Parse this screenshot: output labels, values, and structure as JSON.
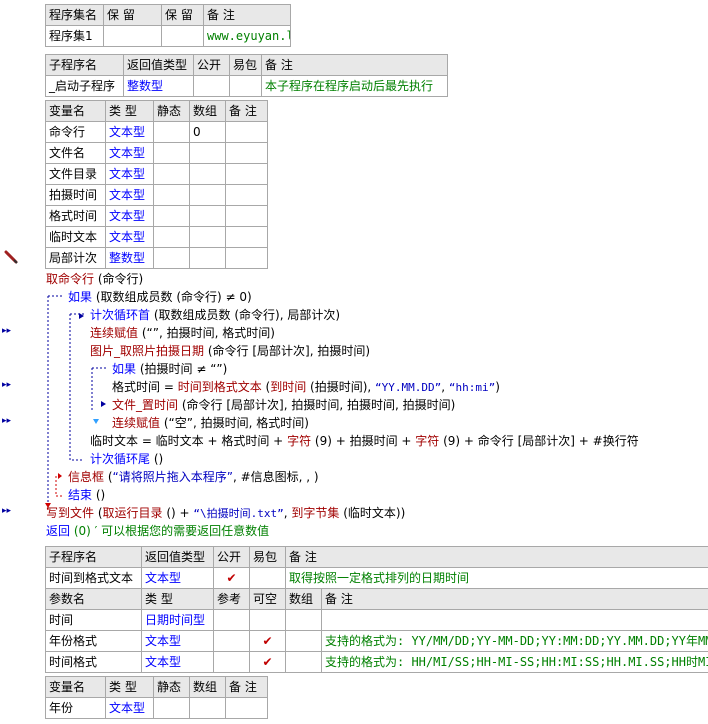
{
  "program_set": {
    "headers": [
      "程序集名",
      "保 留",
      "保 留",
      "备 注"
    ],
    "row": [
      "程序集1",
      "",
      "",
      "www.eyuyan.la"
    ]
  },
  "startup_sub": {
    "headers": [
      "子程序名",
      "返回值类型",
      "公开",
      "易包",
      "备 注"
    ],
    "row": [
      "_启动子程序",
      "整数型",
      "",
      "",
      "本子程序在程序启动后最先执行"
    ]
  },
  "vars1": {
    "headers": [
      "变量名",
      "类 型",
      "静态",
      "数组",
      "备 注"
    ],
    "rows": [
      [
        "命令行",
        "文本型",
        "",
        "0",
        ""
      ],
      [
        "文件名",
        "文本型",
        "",
        "",
        ""
      ],
      [
        "文件目录",
        "文本型",
        "",
        "",
        ""
      ],
      [
        "拍摄时间",
        "文本型",
        "",
        "",
        ""
      ],
      [
        "格式时间",
        "文本型",
        "",
        "",
        ""
      ],
      [
        "临时文本",
        "文本型",
        "",
        "",
        ""
      ],
      [
        "局部计次",
        "整数型",
        "",
        "",
        ""
      ]
    ]
  },
  "code": {
    "l1": [
      "取命令行",
      " (命令行)"
    ],
    "l2": [
      "如果",
      " (取数组成员数 (命令行) ≠ 0)"
    ],
    "l3": [
      "计次循环首",
      " (取数组成员数 (命令行), 局部计次)"
    ],
    "l4": [
      "连续赋值",
      " (“”, 拍摄时间, 格式时间)"
    ],
    "l5": [
      "图片_取照片拍摄日期",
      " (命令行 [局部计次], 拍摄时间)"
    ],
    "l6": [
      "如果",
      " (拍摄时间 ≠ “”)"
    ],
    "l7": [
      "格式时间 = ",
      "时间到格式文本",
      " (",
      "到时间",
      " (拍摄时间), ",
      "“YY.MM.DD”",
      ", ",
      "“hh:mi”",
      ")"
    ],
    "l8": [
      "文件_置时间",
      " (命令行 [局部计次], 拍摄时间, 拍摄时间, 拍摄时间)"
    ],
    "l9": [
      "连续赋值",
      " (“空”, 拍摄时间, 格式时间)"
    ],
    "l10": [
      "临时文本 = 临时文本 + 格式时间 + ",
      "字符",
      " (9) + 拍摄时间 + ",
      "字符",
      " (9) + 命令行 [局部计次] + #换行符"
    ],
    "l11": [
      "计次循环尾",
      " ()"
    ],
    "l12": [
      "信息框",
      " (",
      "“请将照片拖入本程序”",
      ", #信息图标, , )"
    ],
    "l13": [
      "结束",
      " ()"
    ],
    "l14": [
      "写到文件",
      " (",
      "取运行目录",
      " () + ",
      "“\\拍摄时间.txt”",
      ", ",
      "到字节集",
      " (临时文本))"
    ],
    "l15": [
      "返回",
      " (0)  ′ 可以根据您的需要返回任意数值"
    ]
  },
  "time_sub": {
    "headers": [
      "子程序名",
      "返回值类型",
      "公开",
      "易包",
      "备 注"
    ],
    "row": [
      "时间到格式文本",
      "文本型",
      "✔",
      "",
      "取得按照一定格式排列的日期时间"
    ]
  },
  "params": {
    "headers": [
      "参数名",
      "类 型",
      "参考",
      "可空",
      "数组",
      "备 注"
    ],
    "rows": [
      [
        "时间",
        "日期时间型",
        "",
        "",
        "",
        ""
      ],
      [
        "年份格式",
        "文本型",
        "",
        "✔",
        "",
        "支持的格式为: YY/MM/DD;YY-MM-DD;YY:MM:DD;YY.MM.DD;YY年MM月DD日;YY年"
      ],
      [
        "时间格式",
        "文本型",
        "",
        "✔",
        "",
        "支持的格式为: HH/MI/SS;HH-MI-SS;HH:MI:SS;HH.MI.SS;HH时MI分SS秒;HH"
      ]
    ]
  },
  "vars2": {
    "headers": [
      "变量名",
      "类 型",
      "静态",
      "数组",
      "备 注"
    ],
    "rows": [
      [
        "年份",
        "文本型",
        "",
        "",
        ""
      ]
    ]
  },
  "colors": {
    "keyword_red": "#a00000",
    "keyword_blue": "#0000ff",
    "string_blue": "#0000c0",
    "header_gray": "#e8e8e8",
    "comment_green": "#008000"
  },
  "icons": [
    "pencil-icon",
    "breakpoint-arrow-icon"
  ]
}
